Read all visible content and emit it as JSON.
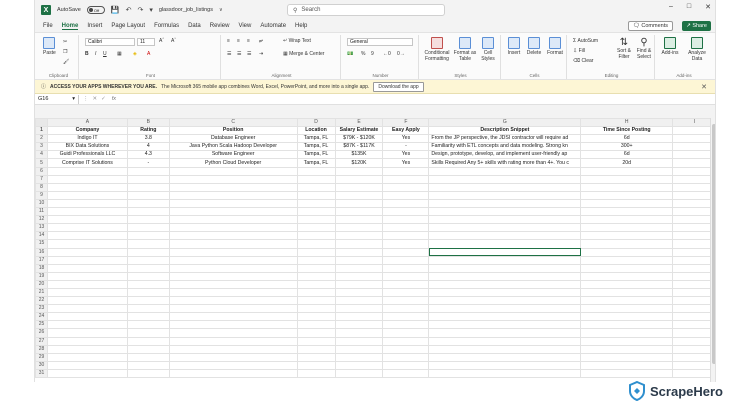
{
  "titlebar": {
    "autosave_label": "AutoSave",
    "autosave_state": "Off",
    "filename": "glassdoor_job_listings",
    "search_placeholder": "Search"
  },
  "menu": {
    "tabs": [
      "File",
      "Home",
      "Insert",
      "Page Layout",
      "Formulas",
      "Data",
      "Review",
      "View",
      "Automate",
      "Help"
    ],
    "active_tab": "Home",
    "comments_label": "Comments",
    "share_label": "Share"
  },
  "ribbon": {
    "clipboard": {
      "paste": "Paste",
      "label": "Clipboard"
    },
    "font": {
      "name": "Calibri",
      "size": "11",
      "label": "Font"
    },
    "alignment": {
      "wrap": "Wrap Text",
      "merge": "Merge & Center",
      "label": "Alignment"
    },
    "number": {
      "format": "General",
      "label": "Number"
    },
    "styles": {
      "conditional": "Conditional Formatting",
      "format_table": "Format as Table",
      "cell_styles": "Cell Styles",
      "label": "Styles"
    },
    "cells": {
      "insert": "Insert",
      "delete": "Delete",
      "format": "Format",
      "label": "Cells"
    },
    "editing": {
      "autosum": "AutoSum",
      "fill": "Fill",
      "clear": "Clear",
      "sort": "Sort & Filter",
      "find": "Find & Select",
      "label": "Editing"
    },
    "addins": {
      "addins": "Add-ins",
      "analyze": "Analyze Data",
      "label": "Add-ins"
    }
  },
  "infobar": {
    "bold_text": "ACCESS YOUR APPS WHEREVER YOU ARE.",
    "text": "The Microsoft 365 mobile app combines Word, Excel, PowerPoint, and more into a single app.",
    "button": "Download the app"
  },
  "formula": {
    "namebox": "G16",
    "fx": "fx",
    "value": ""
  },
  "sheet": {
    "columns": [
      "A",
      "B",
      "C",
      "D",
      "E",
      "F",
      "G",
      "H",
      "I"
    ],
    "headers": [
      "Company",
      "Rating",
      "Position",
      "Location",
      "Salary Estimate",
      "Easy Apply",
      "Description Snippet",
      "Time Since Posting",
      ""
    ],
    "rows": [
      [
        "Indigo IT",
        "3.8",
        "Database Engineer",
        "Tampa, FL",
        "$79K - $120K",
        "Yes",
        "From the JP perspective, the JDSI contractor will require ad",
        "6d",
        ""
      ],
      [
        "BIX Data Solutions",
        "4",
        "Java Python Scala Hadoop Developer",
        "Tampa, FL",
        "$87K - $117K",
        "-",
        "Familiarity with ETL concepts and data modeling. Strong kn",
        "300+",
        ""
      ],
      [
        "Guidi Professionals LLC",
        "4.3",
        "Software Engineer",
        "Tampa, FL",
        "$135K",
        "Yes",
        "Design, prototype, develop, and implement user-friendly ap",
        "6d",
        ""
      ],
      [
        "Comprise IT Solutions",
        "-",
        "Python Cloud Developer",
        "Tampa, FL",
        "$120K",
        "Yes",
        "Skills Required Any 5+ skills with rating more than 4+. You c",
        "20d",
        ""
      ]
    ],
    "total_rows": 31,
    "selected_cell": "G16"
  },
  "brand": {
    "name": "ScrapeHero",
    "color": "#2f8fce"
  },
  "colors": {
    "excel_green": "#1e7145",
    "info_bg": "#fdf6d5"
  }
}
